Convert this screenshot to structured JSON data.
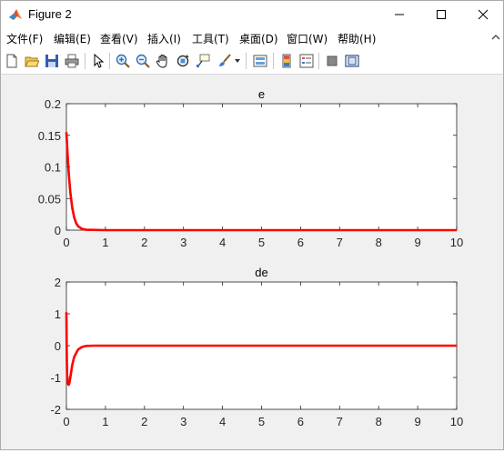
{
  "window": {
    "title": "Figure 2",
    "icon": "matlab-icon",
    "controls": [
      "minimize-icon",
      "maximize-icon",
      "close-icon"
    ]
  },
  "menubar": {
    "items": [
      {
        "label": "文件(F)"
      },
      {
        "label": "编辑(E)"
      },
      {
        "label": "查看(V)"
      },
      {
        "label": "插入(I)"
      },
      {
        "label": "工具(T)"
      },
      {
        "label": "桌面(D)"
      },
      {
        "label": "窗口(W)"
      },
      {
        "label": "帮助(H)"
      }
    ],
    "overflow_icon": "chevron-up-icon"
  },
  "toolbar": {
    "buttons": [
      "new-figure-icon",
      "open-icon",
      "save-icon",
      "print-icon",
      "pointer-icon",
      "zoom-in-icon",
      "zoom-out-icon",
      "pan-icon",
      "rotate-icon",
      "data-cursor-icon",
      "brush-icon",
      "brush-dropdown-icon",
      "link-plot-icon",
      "colorbar-icon",
      "legend-icon",
      "hide-plot-tools-icon",
      "show-plot-tools-icon"
    ]
  },
  "chart_data": [
    {
      "type": "line",
      "title": "e",
      "xlabel": "",
      "ylabel": "",
      "xlim": [
        0,
        10
      ],
      "ylim": [
        0,
        0.2
      ],
      "xticks": [
        "0",
        "1",
        "2",
        "3",
        "4",
        "5",
        "6",
        "7",
        "8",
        "9",
        "10"
      ],
      "yticks": [
        "0",
        "0.05",
        "0.1",
        "0.15",
        "0.2"
      ],
      "grid": false,
      "line_color": "#ff0000",
      "series": [
        {
          "x": [
            0,
            0.03,
            0.06,
            0.1,
            0.15,
            0.2,
            0.25,
            0.3,
            0.4,
            0.5,
            1,
            2,
            4,
            6,
            8,
            10
          ],
          "values": [
            0.155,
            0.12,
            0.09,
            0.06,
            0.035,
            0.02,
            0.011,
            0.006,
            0.002,
            0.0006,
            0,
            0,
            0,
            0,
            0,
            0
          ]
        }
      ]
    },
    {
      "type": "line",
      "title": "de",
      "xlabel": "",
      "ylabel": "",
      "xlim": [
        0,
        10
      ],
      "ylim": [
        -2,
        2
      ],
      "xticks": [
        "0",
        "1",
        "2",
        "3",
        "4",
        "5",
        "6",
        "7",
        "8",
        "9",
        "10"
      ],
      "yticks": [
        "-2",
        "-1",
        "0",
        "1",
        "2"
      ],
      "grid": false,
      "line_color": "#ff0000",
      "series": [
        {
          "x": [
            0,
            0.005,
            0.01,
            0.02,
            0.04,
            0.06,
            0.08,
            0.1,
            0.15,
            0.2,
            0.3,
            0.4,
            0.5,
            0.7,
            1,
            2,
            4,
            6,
            8,
            10
          ],
          "values": [
            1.05,
            0.3,
            -0.4,
            -1.0,
            -1.2,
            -1.23,
            -1.15,
            -1.0,
            -0.6,
            -0.35,
            -0.12,
            -0.04,
            -0.01,
            0,
            0,
            0,
            0,
            0,
            0,
            0
          ]
        }
      ]
    }
  ]
}
